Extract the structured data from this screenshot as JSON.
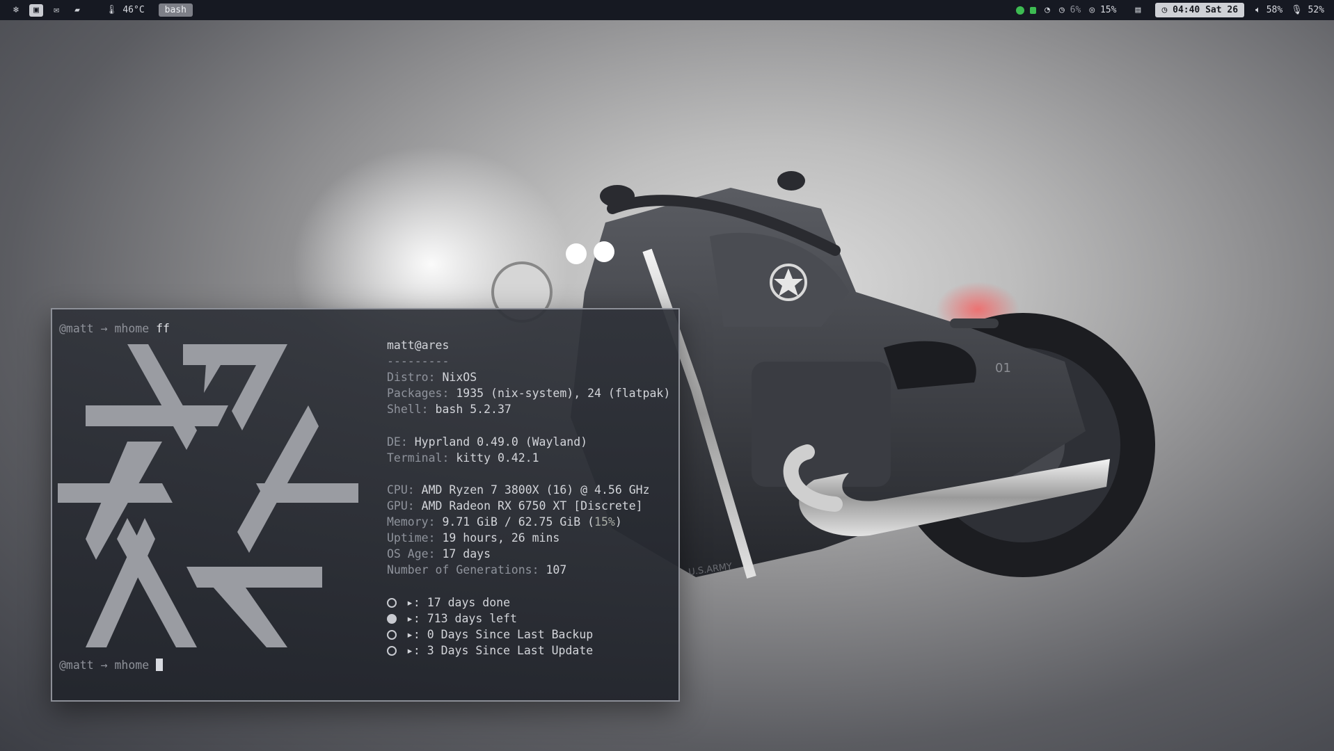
{
  "topbar": {
    "left_icons": [
      "nixos-icon",
      "terminal-icon",
      "mail-icon",
      "folder-icon"
    ],
    "temperature": "46°C",
    "workspace_tag": "bash",
    "cpu_usage": "6%",
    "memory_usage": "15%",
    "clock": "04:40 Sat 26",
    "volume": "58%",
    "mic": "52%"
  },
  "terminal": {
    "prompt1": "@matt → mhome",
    "command1": " ff",
    "prompt2": "@matt → mhome",
    "fetch": {
      "user": "matt",
      "at": "@",
      "host": "ares",
      "separator": "---------",
      "distro_key": "Distro:",
      "distro": " NixOS",
      "packages_key": "Packages:",
      "packages": " 1935 (nix-system), 24 (flatpak)",
      "shell_key": "Shell:",
      "shell": " bash 5.2.37",
      "de_key": "DE:",
      "de": " Hyprland 0.49.0 (Wayland)",
      "terminal_key": "Terminal:",
      "terminal": " kitty 0.42.1",
      "cpu_key": "CPU:",
      "cpu": " AMD Ryzen 7 3800X (16) @ 4.56 GHz",
      "gpu_key": "GPU:",
      "gpu": " AMD Radeon RX 6750 XT [Discrete]",
      "memory_key": "Memory:",
      "memory": " 9.71 GiB / 62.75 GiB (",
      "memory_pct": "15%",
      "memory_close": ")",
      "uptime_key": "Uptime:",
      "uptime": " 19 hours, 26 mins",
      "osage_key": "OS Age:",
      "osage": " 17 days",
      "generations_key": "Number of Generations:",
      "generations": " 107",
      "custom1": "▸: 17 days done",
      "custom2": "▸: 713 days left",
      "custom3": "▸: 0 Days Since Last Backup",
      "custom4": "▸: 3 Days Since Last Update"
    }
  },
  "colors": {
    "bar_bg": "#161922",
    "accent_green": "#3dbb52",
    "terminal_bg": "#2b2e35"
  }
}
